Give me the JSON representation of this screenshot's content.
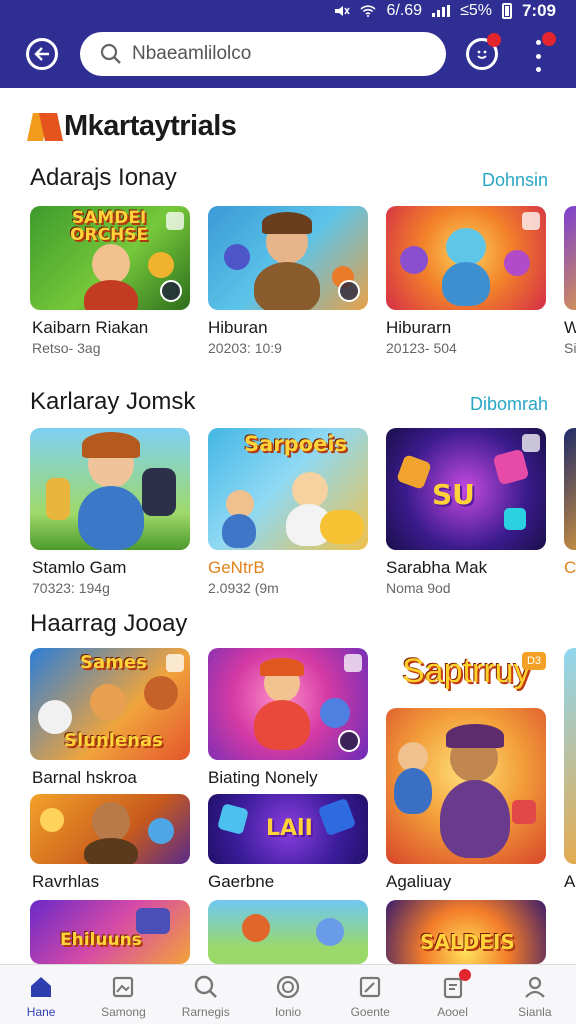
{
  "status_bar": {
    "signal_text": "6/.69",
    "battery_text": "≤5%",
    "time": "7:09"
  },
  "search": {
    "placeholder": "Nbaeamlilolco"
  },
  "brand": {
    "name": "Mkartaytrials"
  },
  "sections": [
    {
      "title": "Adarajs Ionay",
      "see_more": "Dohnsin",
      "cards": [
        {
          "title": "Kaibarn Riakan",
          "subtitle": "Retso- 3ag"
        },
        {
          "title": "Hiburan",
          "subtitle": "20203: 10:9"
        },
        {
          "title": "Hiburarn",
          "subtitle": "20123- 504"
        },
        {
          "title": "W",
          "subtitle": "Si"
        }
      ]
    },
    {
      "title": "Karlaray Jomsk",
      "see_more": "Dibomrah",
      "cards": [
        {
          "title": "Stamlo Gam",
          "subtitle": "70323: 194g"
        },
        {
          "title": "GeNtrB",
          "subtitle": "2.0932 (9m"
        },
        {
          "title": "Sarabha Mak",
          "subtitle": "Noma 9od"
        },
        {
          "title": "C",
          "subtitle": ""
        }
      ]
    },
    {
      "title": "Haarrag Jooay",
      "cards": [
        {
          "title": "Barnal hskroa"
        },
        {
          "title": "Biating Nonely"
        },
        {
          "title": "Agaliuay"
        },
        {
          "title": "Ravrhlas"
        },
        {
          "title": "Gaerbne"
        },
        {
          "title": "A"
        }
      ]
    }
  ],
  "art_text": {
    "a1": "SAMDEI ORCHSE",
    "b1": "Sarpoeis",
    "b2": "SU",
    "c1": "Sames",
    "c1b": "Slunlenas",
    "c_big": "Saptrruy",
    "c_big_small": "D3",
    "c2": "LAlI",
    "c3": "Ehiluuns",
    "c4": "SALDEIS"
  },
  "bottom_nav": [
    {
      "label": "Hane",
      "icon": "home-icon"
    },
    {
      "label": "Samong",
      "icon": "image-icon"
    },
    {
      "label": "Rarnegis",
      "icon": "search-icon"
    },
    {
      "label": "Ionio",
      "icon": "circle-icon"
    },
    {
      "label": "Goente",
      "icon": "edit-icon"
    },
    {
      "label": "Aooel",
      "icon": "notification-icon"
    },
    {
      "label": "Sianla",
      "icon": "profile-icon"
    }
  ],
  "colors": {
    "top_bar": "#2f2f93",
    "accent_link": "#28a6c4",
    "active_nav": "#2f3fb0",
    "badge": "#e3262d"
  }
}
